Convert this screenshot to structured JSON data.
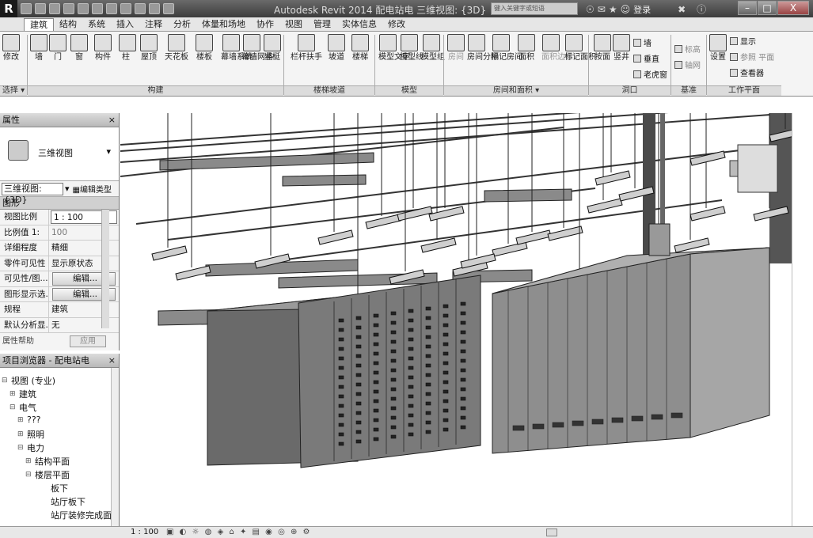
{
  "titlebar": {
    "app_logo": "R",
    "title": "Autodesk Revit 2014    配电站电    三维视图: {3D}",
    "search_placeholder": "键入关键字或短语",
    "login": "登录",
    "win_min": "–",
    "win_max": "□",
    "win_close": "X"
  },
  "tabs": [
    {
      "label": "建筑",
      "active": true
    },
    {
      "label": "结构"
    },
    {
      "label": "系统"
    },
    {
      "label": "插入"
    },
    {
      "label": "注释"
    },
    {
      "label": "分析"
    },
    {
      "label": "体量和场地"
    },
    {
      "label": "协作"
    },
    {
      "label": "视图"
    },
    {
      "label": "管理"
    },
    {
      "label": "实体信息"
    },
    {
      "label": "修改"
    }
  ],
  "ribbon": {
    "buttons": [
      {
        "label": "修改"
      },
      {
        "label": "墙"
      },
      {
        "label": "门"
      },
      {
        "label": "窗"
      },
      {
        "label": "构件"
      },
      {
        "label": "柱"
      },
      {
        "label": "屋顶"
      },
      {
        "label": "天花板"
      },
      {
        "label": "楼板"
      },
      {
        "label": "幕墙系统"
      },
      {
        "label": "幕墙网格"
      },
      {
        "label": "竖梃"
      },
      {
        "label": "栏杆扶手"
      },
      {
        "label": "坡道"
      },
      {
        "label": "楼梯"
      },
      {
        "label": "模型文字"
      },
      {
        "label": "模型线"
      },
      {
        "label": "模型组"
      },
      {
        "label": "房间"
      },
      {
        "label": "房间分隔"
      },
      {
        "label": "标记房间"
      },
      {
        "label": "面积"
      },
      {
        "label": "面积边界"
      },
      {
        "label": "标记面积"
      },
      {
        "label": "按面"
      },
      {
        "label": "竖井"
      },
      {
        "label": "设置"
      }
    ],
    "small": {
      "opening_wall": "墙",
      "opening_vertical": "垂直",
      "opening_dormer": "老虎窗",
      "datum_level": "标高",
      "datum_grid": "轴网",
      "wp_show": "显示",
      "wp_ref": "参照 平面",
      "wp_viewer": "查看器"
    },
    "groups": {
      "select": "选择 ▾",
      "build": "构建",
      "circulation": "楼梯坡道",
      "model": "模型",
      "room_area": "房间和面积 ▾",
      "opening": "洞口",
      "datum": "基准",
      "workplane": "工作平面"
    }
  },
  "properties": {
    "title": "属性",
    "close": "×",
    "type_name": "三维视图",
    "view_select": "三维视图: {3D}",
    "edit_type": "编辑类型",
    "category": "图形",
    "rows": [
      {
        "k": "视图比例",
        "v": "1 : 100"
      },
      {
        "k": "比例值 1:",
        "v": "100"
      },
      {
        "k": "详细程度",
        "v": "精细"
      },
      {
        "k": "零件可见性",
        "v": "显示原状态"
      },
      {
        "k": "可见性/图...",
        "v": "编辑..."
      },
      {
        "k": "图形显示选...",
        "v": "编辑..."
      },
      {
        "k": "规程",
        "v": "建筑"
      },
      {
        "k": "默认分析显...",
        "v": "无"
      }
    ],
    "help": "属性帮助",
    "apply": "应用"
  },
  "browser": {
    "title": "项目浏览器 - 配电站电",
    "close": "×",
    "items": [
      {
        "label": "视图 (专业)",
        "toggle": "⊟"
      },
      {
        "label": "建筑",
        "toggle": "⊞"
      },
      {
        "label": "电气",
        "toggle": "⊟"
      },
      {
        "label": "???",
        "toggle": "⊞"
      },
      {
        "label": "照明",
        "toggle": "⊞"
      },
      {
        "label": "电力",
        "toggle": "⊟"
      },
      {
        "label": "结构平面",
        "toggle": "⊞"
      },
      {
        "label": "楼层平面",
        "toggle": "⊟"
      },
      {
        "label": "板下",
        "toggle": ""
      },
      {
        "label": "站厅板下",
        "toggle": ""
      },
      {
        "label": "站厅装修完成面",
        "toggle": ""
      }
    ]
  },
  "status": {
    "scale": "1 : 100"
  },
  "colors": {
    "titlebar": "#4a4a4a",
    "ribbon": "#f4f4f4",
    "cabinet_dark": "#5a5a5a",
    "cabinet_light": "#9a9a9a"
  }
}
